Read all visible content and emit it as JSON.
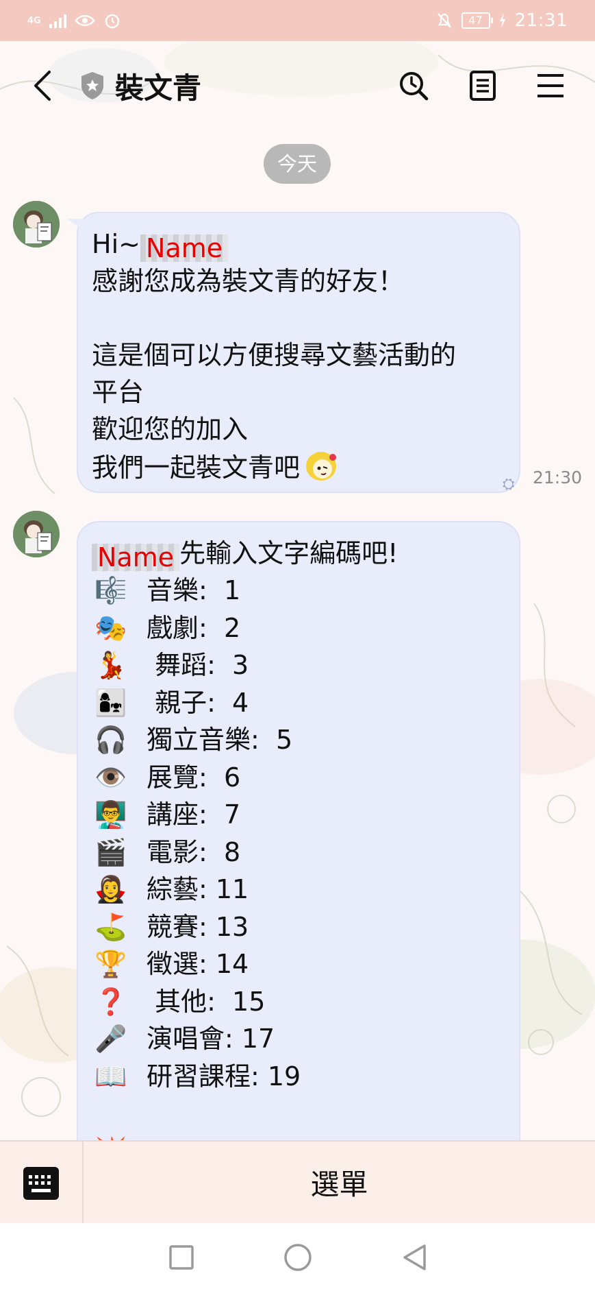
{
  "status_bar": {
    "network": "4G",
    "battery": "47",
    "time": "21:31"
  },
  "header": {
    "title": "裝文青",
    "icons": [
      "back-icon",
      "shield-icon",
      "clock-search-icon",
      "notes-icon",
      "menu-icon"
    ]
  },
  "date_chip": "今天",
  "message1": {
    "greeting": "Hi~",
    "name": "Name",
    "lines": [
      "感謝您成為裝文青的好友！",
      "",
      "這是個可以方便搜尋文藝活動的",
      "平台",
      "歡迎您的加入",
      "我們一起裝文青吧"
    ],
    "time": "21:30"
  },
  "message2": {
    "name": "Name",
    "title": "先輸入文字編碼吧!",
    "items": [
      {
        "emoji": "🎼",
        "label": "音樂:  1"
      },
      {
        "emoji": "🎭",
        "label": "戲劇:  2"
      },
      {
        "emoji": "💃",
        "label": " 舞蹈:  3"
      },
      {
        "emoji": "👩‍👧",
        "label": " 親子:  4"
      },
      {
        "emoji": "🎧",
        "label": "獨立音樂:  5"
      },
      {
        "emoji": "👁️",
        "label": "展覽:  6"
      },
      {
        "emoji": "👨‍🏫",
        "label": "講座:  7"
      },
      {
        "emoji": "🎬",
        "label": "電影:  8"
      },
      {
        "emoji": "🧛‍♀️",
        "label": "綜藝: 11"
      },
      {
        "emoji": "⛳",
        "label": "競賽: 13"
      },
      {
        "emoji": "🏆",
        "label": "徵選: 14"
      },
      {
        "emoji": "❓",
        "label": " 其他:  15"
      },
      {
        "emoji": "🎤",
        "label": "演唱會: 17"
      },
      {
        "emoji": "📖",
        "label": "研習課程: 19"
      }
    ]
  },
  "bottom_bar": {
    "menu_label": "選單"
  },
  "colors": {
    "status_bar": "#f4c9bf",
    "bubble": "#e9edfb",
    "name_highlight": "#e60000",
    "bottom_bar": "#fcefe9"
  }
}
